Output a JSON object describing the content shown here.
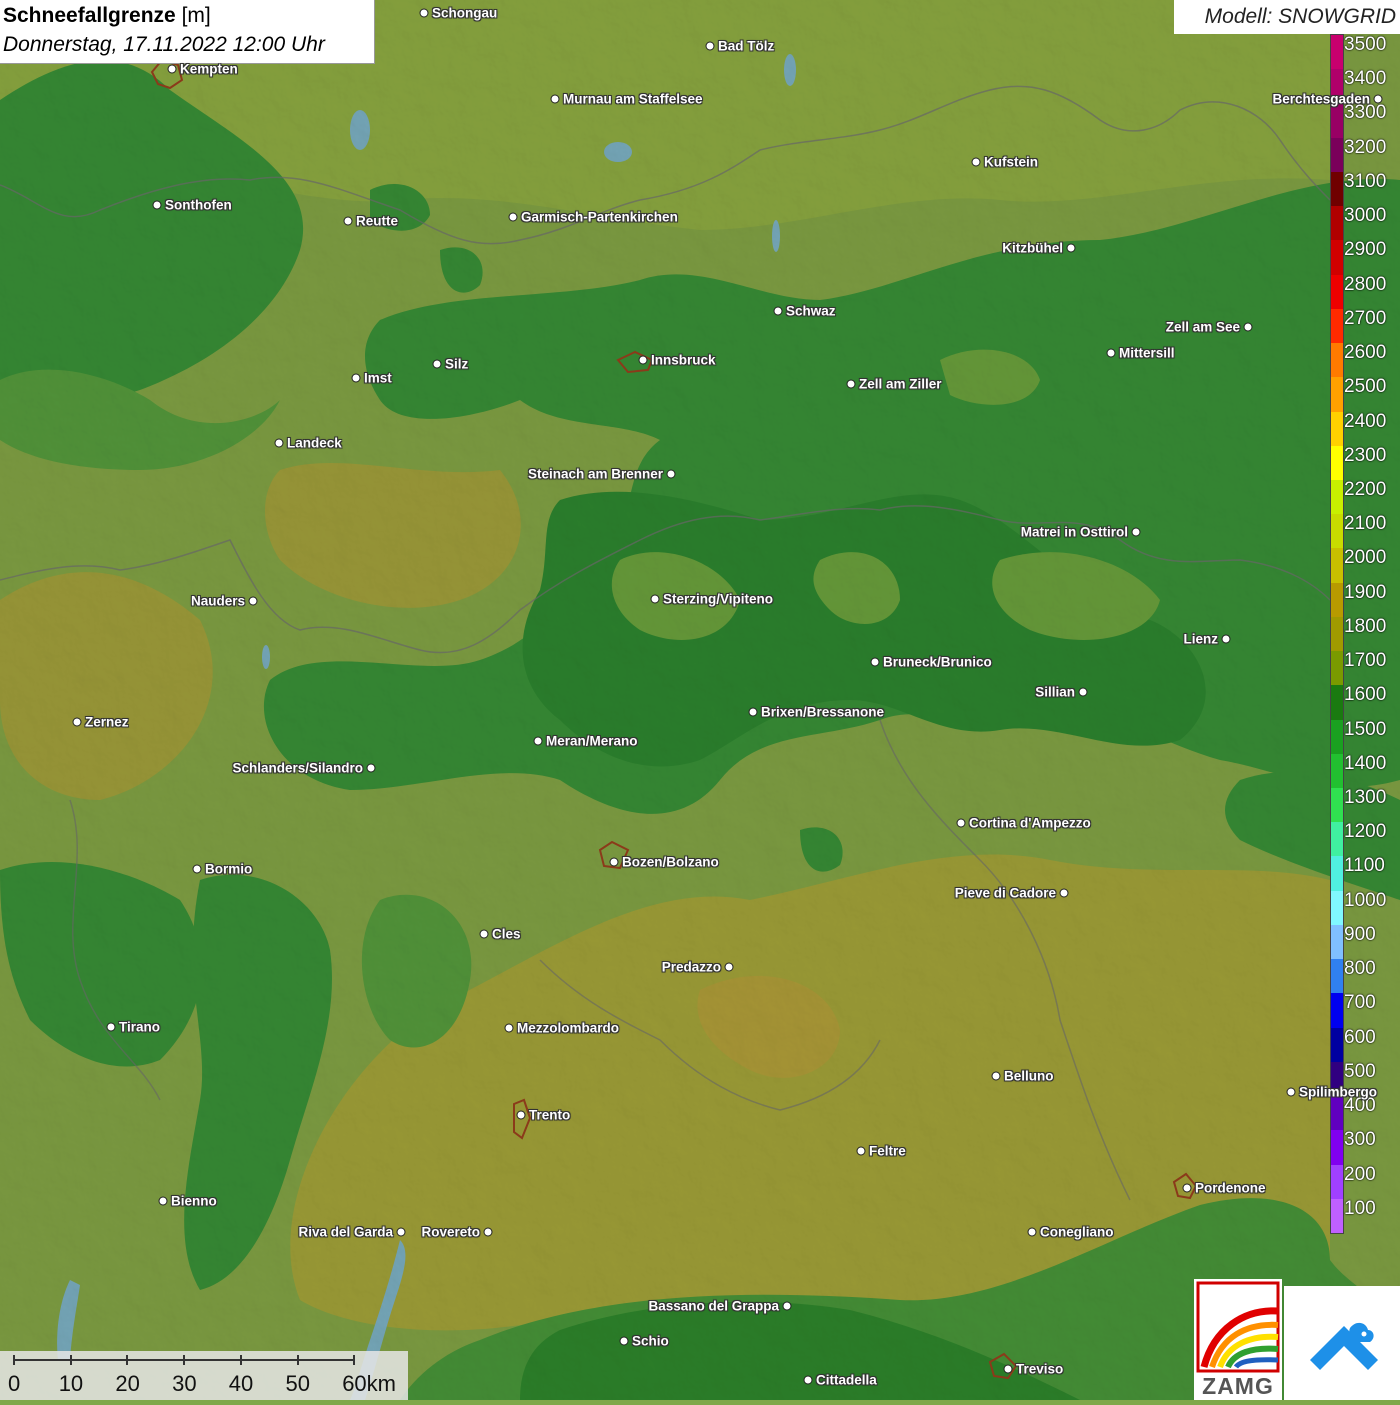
{
  "title": {
    "main": "Schneefallgrenze",
    "unit": "[m]",
    "datetime": "Donnerstag, 17.11.2022 12:00 Uhr"
  },
  "model": "Modell: SNOWGRID",
  "legend": {
    "values": [
      "3500",
      "3400",
      "3300",
      "3200",
      "3100",
      "3000",
      "2900",
      "2800",
      "2700",
      "2600",
      "2500",
      "2400",
      "2300",
      "2200",
      "2100",
      "2000",
      "1900",
      "1800",
      "1700",
      "1600",
      "1500",
      "1400",
      "1300",
      "1200",
      "1100",
      "1000",
      "900",
      "800",
      "700",
      "600",
      "500",
      "400",
      "300",
      "200",
      "100"
    ],
    "colors": [
      "#c8006e",
      "#b0006a",
      "#980064",
      "#7a005a",
      "#700000",
      "#b00000",
      "#d00000",
      "#ee0000",
      "#ff2a00",
      "#ff7a00",
      "#ffa000",
      "#ffd000",
      "#ffff00",
      "#c8f000",
      "#c8dc00",
      "#c8c000",
      "#b89a00",
      "#a09a00",
      "#7a9a00",
      "#1a7a10",
      "#1aa020",
      "#22c030",
      "#30e050",
      "#40f0a0",
      "#50f0e0",
      "#80f8ff",
      "#80c0ff",
      "#3080f0",
      "#0000f0",
      "#0000a0",
      "#300080",
      "#6000c0",
      "#8000f0",
      "#a040ff",
      "#c060ff"
    ]
  },
  "cities": [
    {
      "name": "Schongau",
      "label_side": "right"
    },
    {
      "name": "Bad Tölz",
      "label_side": "right"
    },
    {
      "name": "Kempten",
      "label_side": "right"
    },
    {
      "name": "Murnau am Staffelsee",
      "label_side": "right"
    },
    {
      "name": "Berchtesgaden",
      "label_side": "left"
    },
    {
      "name": "Kufstein",
      "label_side": "right"
    },
    {
      "name": "Sonthofen",
      "label_side": "right"
    },
    {
      "name": "Reutte",
      "label_side": "right"
    },
    {
      "name": "Garmisch-Partenkirchen",
      "label_side": "right"
    },
    {
      "name": "Kitzbühel",
      "label_side": "left"
    },
    {
      "name": "Schwaz",
      "label_side": "right"
    },
    {
      "name": "Zell am See",
      "label_side": "left"
    },
    {
      "name": "Innsbruck",
      "label_side": "right"
    },
    {
      "name": "Mittersill",
      "label_side": "right"
    },
    {
      "name": "Imst",
      "label_side": "right"
    },
    {
      "name": "Silz",
      "label_side": "right"
    },
    {
      "name": "Zell am Ziller",
      "label_side": "right"
    },
    {
      "name": "Landeck",
      "label_side": "right"
    },
    {
      "name": "Steinach am Brenner",
      "label_side": "left"
    },
    {
      "name": "Matrei in Osttirol",
      "label_side": "left"
    },
    {
      "name": "Nauders",
      "label_side": "left"
    },
    {
      "name": "Sterzing/Vipiteno",
      "label_side": "right"
    },
    {
      "name": "Lienz",
      "label_side": "left"
    },
    {
      "name": "Bruneck/Brunico",
      "label_side": "right"
    },
    {
      "name": "Sillian",
      "label_side": "left"
    },
    {
      "name": "Brixen/Bressanone",
      "label_side": "right"
    },
    {
      "name": "Zernez",
      "label_side": "right"
    },
    {
      "name": "Meran/Merano",
      "label_side": "right"
    },
    {
      "name": "Schlanders/Silandro",
      "label_side": "left"
    },
    {
      "name": "Cortina d'Ampezzo",
      "label_side": "right"
    },
    {
      "name": "Bormio",
      "label_side": "right"
    },
    {
      "name": "Bozen/Bolzano",
      "label_side": "right"
    },
    {
      "name": "Pieve di Cadore",
      "label_side": "left"
    },
    {
      "name": "Cles",
      "label_side": "right"
    },
    {
      "name": "Predazzo",
      "label_side": "left"
    },
    {
      "name": "Tirano",
      "label_side": "right"
    },
    {
      "name": "Mezzolombardo",
      "label_side": "right"
    },
    {
      "name": "Belluno",
      "label_side": "right"
    },
    {
      "name": "Spilimbergo",
      "label_side": "right"
    },
    {
      "name": "Trento",
      "label_side": "right"
    },
    {
      "name": "Feltre",
      "label_side": "right"
    },
    {
      "name": "Pordenone",
      "label_side": "right"
    },
    {
      "name": "Bienno",
      "label_side": "right"
    },
    {
      "name": "Riva del Garda",
      "label_side": "left"
    },
    {
      "name": "Rovereto",
      "label_side": "left"
    },
    {
      "name": "Conegliano",
      "label_side": "right"
    },
    {
      "name": "Bassano del Grappa",
      "label_side": "left"
    },
    {
      "name": "Schio",
      "label_side": "right"
    },
    {
      "name": "Treviso",
      "label_side": "right"
    },
    {
      "name": "Cittadella",
      "label_side": "right"
    }
  ],
  "scale": {
    "ticks": [
      "0",
      "10",
      "20",
      "30",
      "40",
      "50",
      "60km"
    ]
  },
  "logos": {
    "zamg": "ZAMG"
  }
}
